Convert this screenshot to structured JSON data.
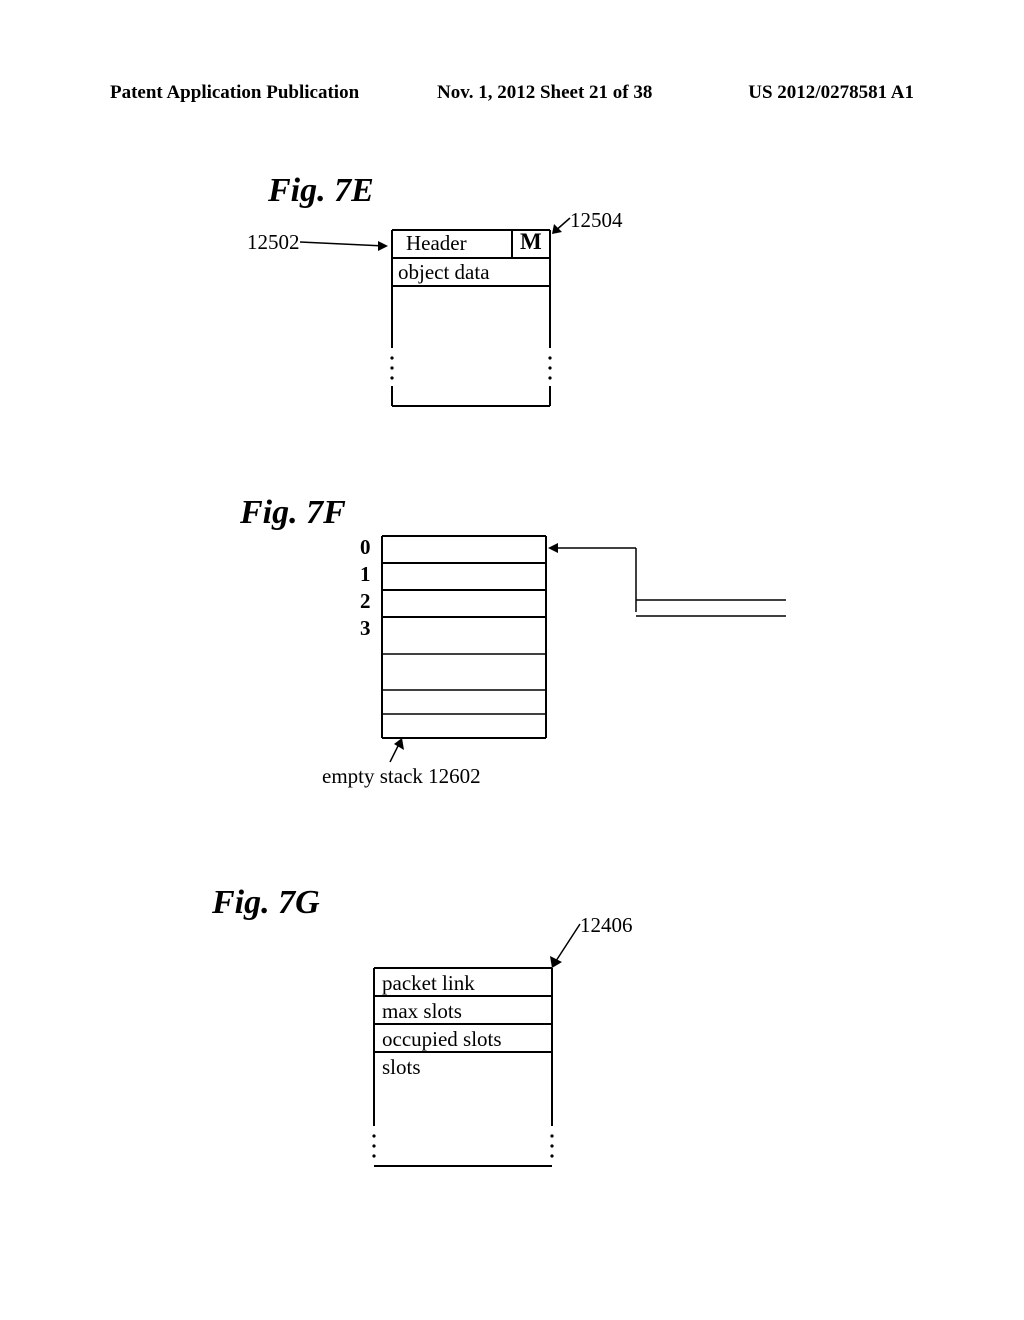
{
  "header": {
    "left": "Patent Application Publication",
    "middle": "Nov. 1, 2012  Sheet 21 of 38",
    "right": "US 2012/0278581 A1"
  },
  "fig7e": {
    "title": "Fig. 7E",
    "ref_left": "12502",
    "ref_right": "12504",
    "cell_header": "Header",
    "cell_m": "M",
    "cell_data": "object data"
  },
  "fig7f": {
    "title": "Fig. 7F",
    "idx0": "0",
    "idx1": "1",
    "idx2": "2",
    "idx3": "3",
    "caption": "empty stack  12602"
  },
  "fig7g": {
    "title": "Fig. 7G",
    "ref": "12406",
    "row1": "packet link",
    "row2": "max slots",
    "row3": "occupied slots",
    "row4": "slots"
  }
}
